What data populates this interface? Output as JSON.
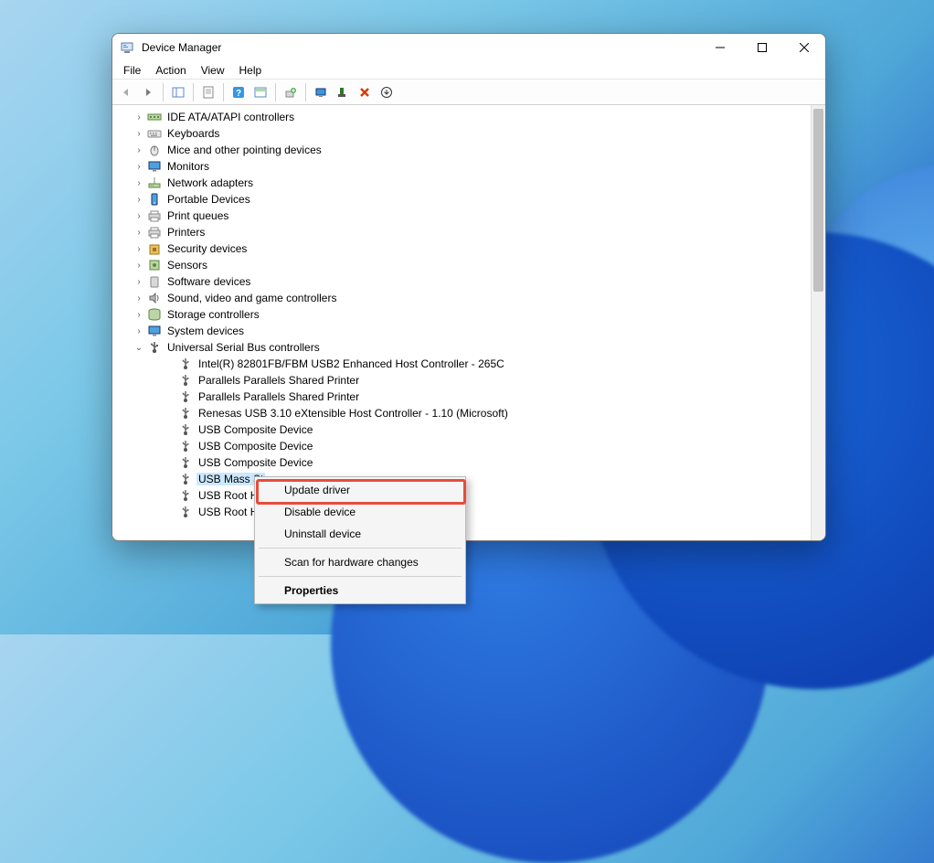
{
  "window": {
    "title": "Device Manager"
  },
  "menu": {
    "file": "File",
    "action": "Action",
    "view": "View",
    "help": "Help"
  },
  "tree": {
    "collapsed": [
      "IDE ATA/ATAPI controllers",
      "Keyboards",
      "Mice and other pointing devices",
      "Monitors",
      "Network adapters",
      "Portable Devices",
      "Print queues",
      "Printers",
      "Security devices",
      "Sensors",
      "Software devices",
      "Sound, video and game controllers",
      "Storage controllers",
      "System devices"
    ],
    "expanded": {
      "label": "Universal Serial Bus controllers",
      "children": [
        "Intel(R) 82801FB/FBM USB2 Enhanced Host Controller - 265C",
        "Parallels Parallels Shared Printer",
        "Parallels Parallels Shared Printer",
        "Renesas USB 3.10 eXtensible Host Controller - 1.10 (Microsoft)",
        "USB Composite Device",
        "USB Composite Device",
        "USB Composite Device",
        "USB Mass Storage Device",
        "USB Root Hub",
        "USB Root Hub"
      ],
      "truncated": [
        "USB Mass St",
        "USB Root Hu",
        "USB Root Hu"
      ]
    }
  },
  "context_menu": {
    "update": "Update driver",
    "disable": "Disable device",
    "uninstall": "Uninstall device",
    "scan": "Scan for hardware changes",
    "properties": "Properties"
  }
}
